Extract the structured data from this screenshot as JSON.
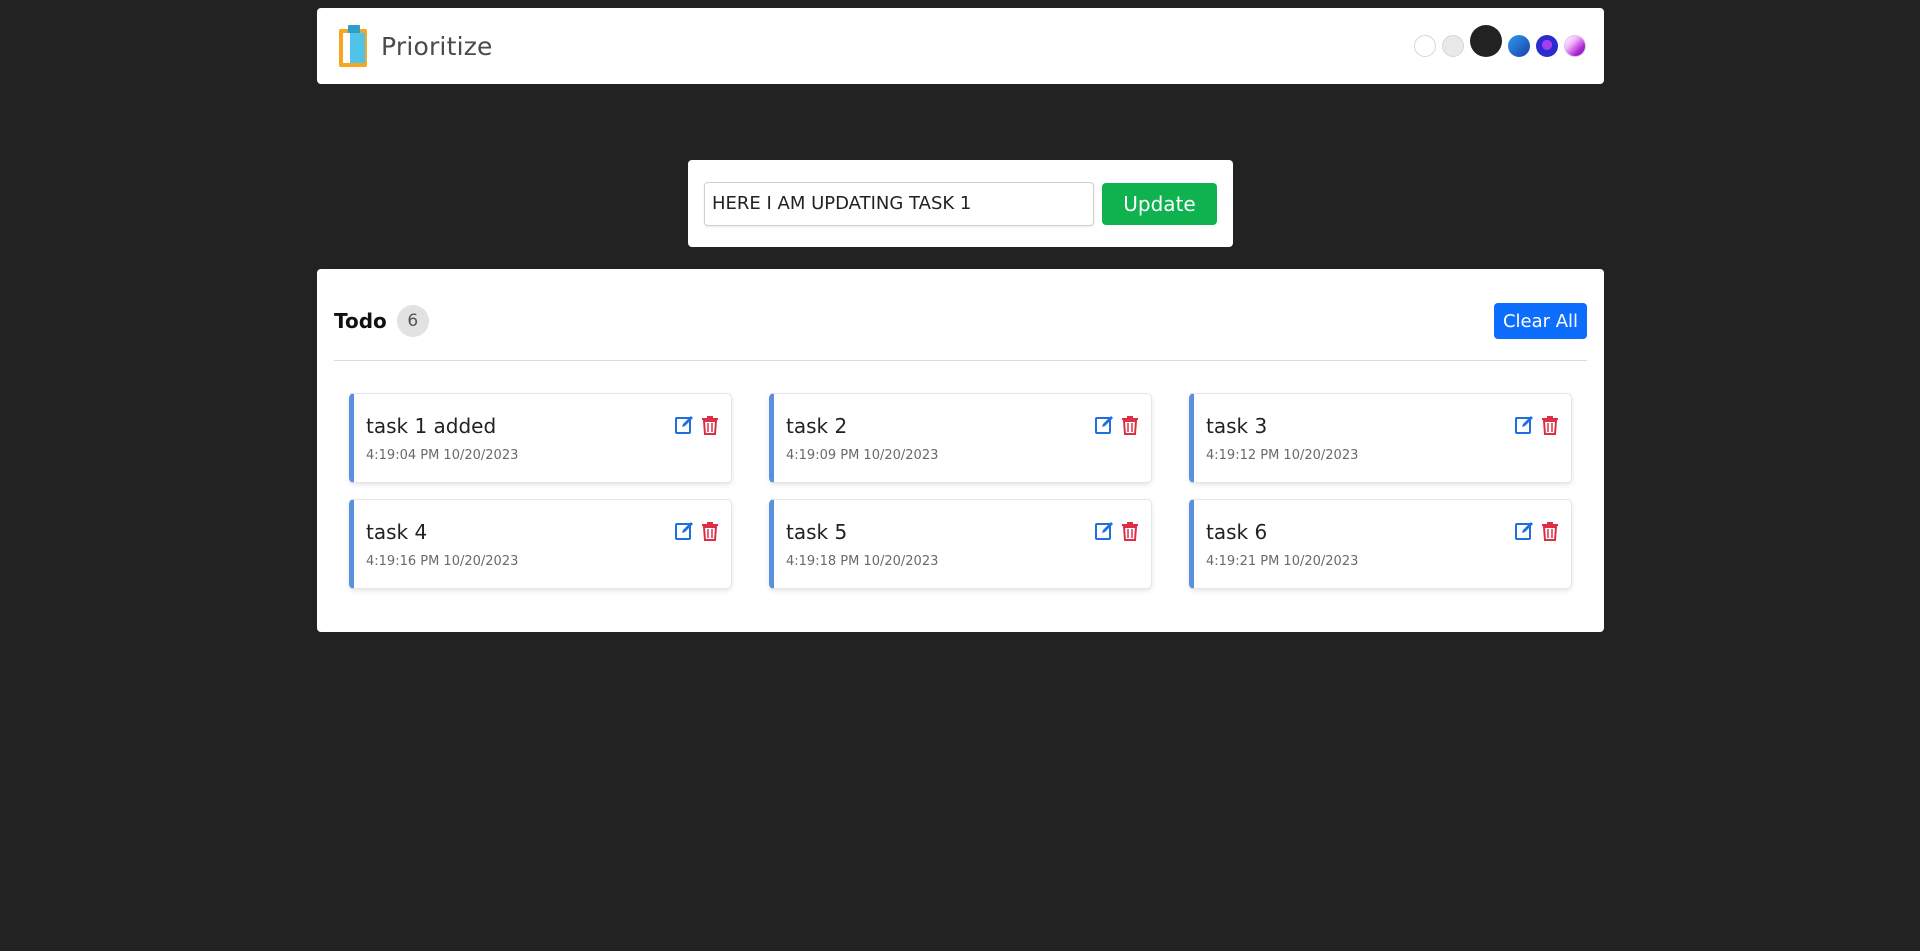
{
  "app": {
    "title": "Prioritize"
  },
  "themes": [
    "light",
    "gray",
    "dark",
    "blue",
    "purple",
    "pink"
  ],
  "form": {
    "input_value": "HERE I AM UPDATING TASK 1",
    "update_label": "Update"
  },
  "todo": {
    "title": "Todo",
    "count": "6",
    "clear_label": "Clear All",
    "tasks": [
      {
        "name": "task 1 added",
        "time": "4:19:04 PM 10/20/2023"
      },
      {
        "name": "task 2",
        "time": "4:19:09 PM 10/20/2023"
      },
      {
        "name": "task 3",
        "time": "4:19:12 PM 10/20/2023"
      },
      {
        "name": "task 4",
        "time": "4:19:16 PM 10/20/2023"
      },
      {
        "name": "task 5",
        "time": "4:19:18 PM 10/20/2023"
      },
      {
        "name": "task 6",
        "time": "4:19:21 PM 10/20/2023"
      }
    ]
  },
  "colors": {
    "background": "#222222",
    "update_button": "#0fb24f",
    "clear_button": "#0d6efd",
    "card_accent": "#5b8fe0",
    "edit_icon": "#1f6fe0",
    "delete_icon": "#dc2f45"
  },
  "icons": {
    "edit": "edit-icon",
    "delete": "trash-icon",
    "logo": "clipboard-logo"
  }
}
